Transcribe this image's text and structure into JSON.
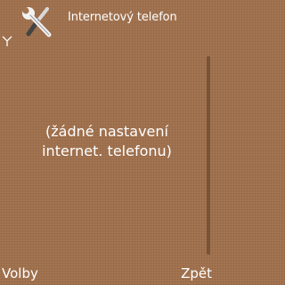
{
  "header": {
    "title": "Internetový telefon",
    "app_icon": "wrench-screwdriver-icon",
    "signal_icon": "antenna-icon"
  },
  "main": {
    "message_line1": "(žádné nastavení",
    "message_line2": "internet. telefonu)"
  },
  "softkeys": {
    "left": "Volby",
    "right": "Zpět"
  },
  "colors": {
    "background": "#a37450",
    "text": "#ffffff"
  }
}
